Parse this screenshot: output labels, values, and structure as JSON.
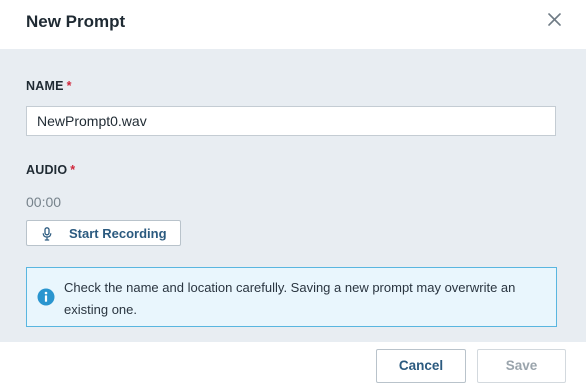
{
  "dialog": {
    "title": "New Prompt",
    "close_icon": "close-icon"
  },
  "form": {
    "name_label": "NAME",
    "required_marker": "*",
    "name_value": "NewPrompt0.wav",
    "audio_label": "AUDIO",
    "timer": "00:00",
    "record_icon": "microphone-icon",
    "record_label": "Start Recording"
  },
  "info": {
    "icon": "info-icon",
    "message": "Check the name and location carefully. Saving a new prompt may overwrite an existing one."
  },
  "footer": {
    "cancel_label": "Cancel",
    "save_label": "Save",
    "save_disabled": true
  },
  "colors": {
    "accent": "#2b5a7f",
    "required": "#d0263b",
    "info_border": "#59b6e0",
    "info_background": "#e9f6fd",
    "info_icon": "#2a95cf",
    "body_background": "#e8edf2"
  }
}
